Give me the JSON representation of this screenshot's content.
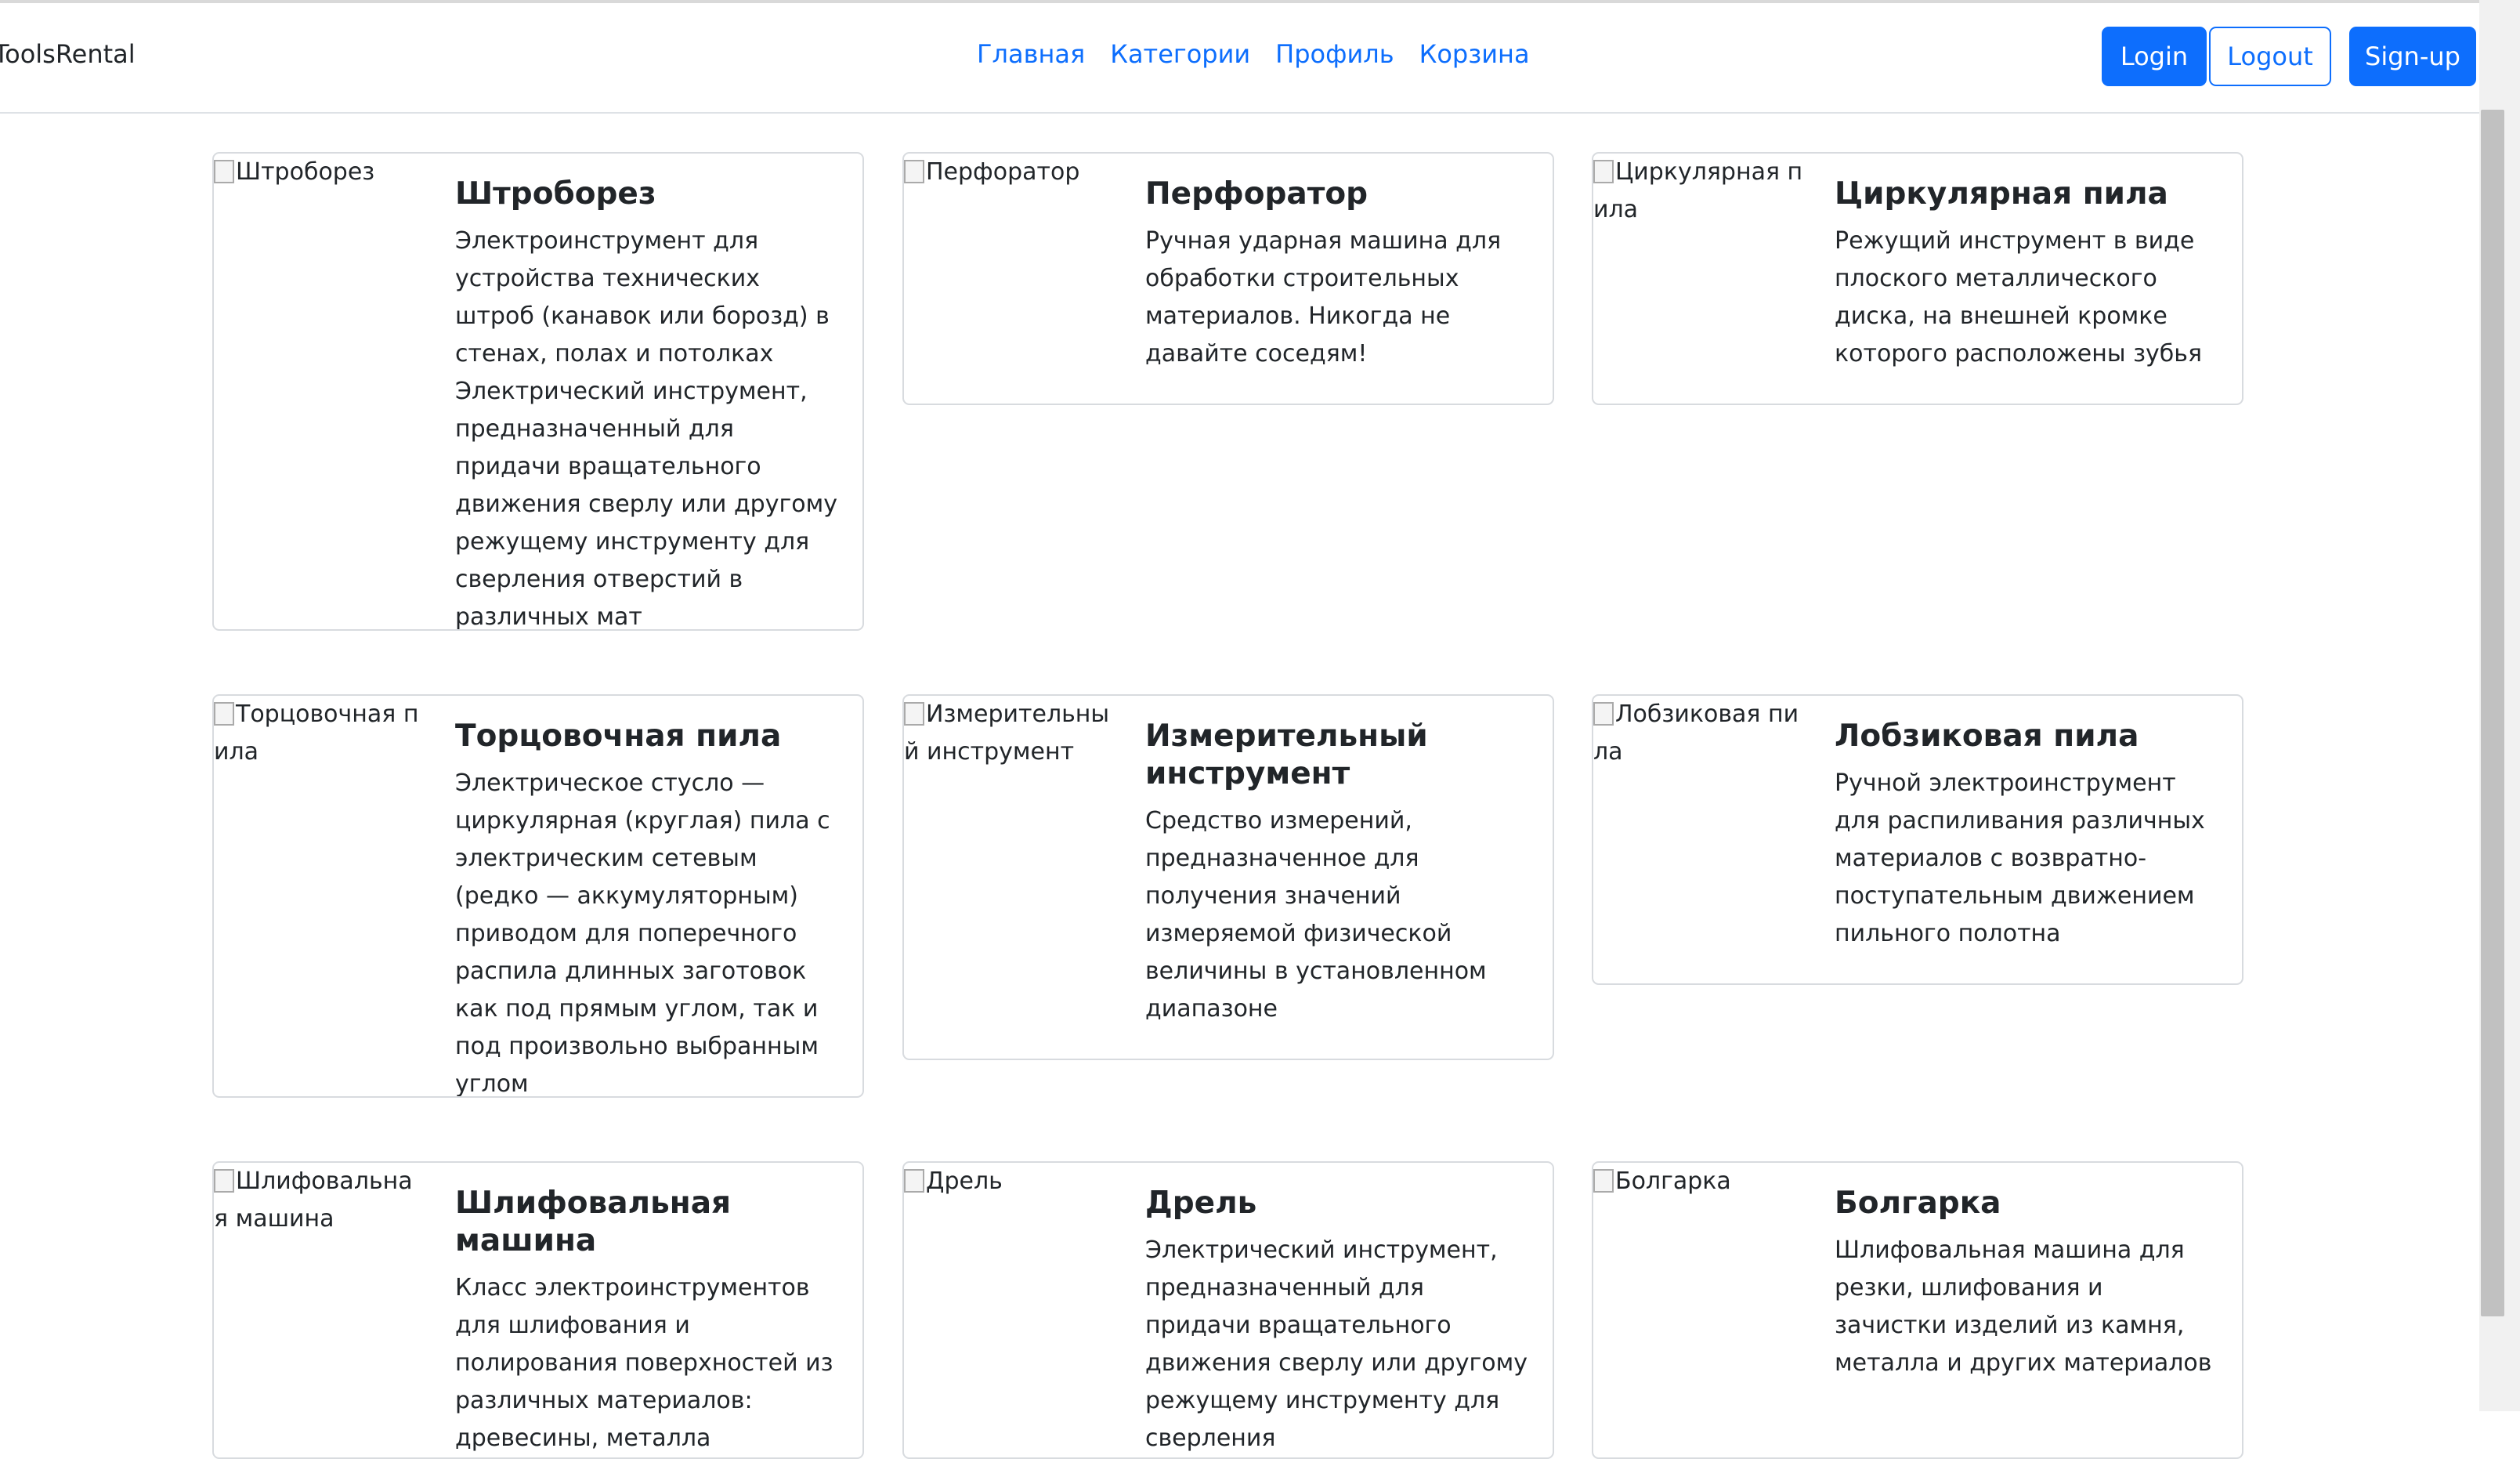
{
  "navbar": {
    "brand": "ToolsRental",
    "links": [
      "Главная",
      "Категории",
      "Профиль",
      "Корзина"
    ],
    "login": "Login",
    "logout": "Logout",
    "signup": "Sign-up"
  },
  "products": [
    {
      "img_alt": "Штроборез",
      "title": "Штроборез",
      "text": "Электроинструмент для устройства технических штроб (канавок или борозд) в стенах, полах и потолках Электрический инструмент, предназначенный для придачи вращательного движения сверлу или другому режущему инструменту для сверления отверстий в различных мат"
    },
    {
      "img_alt": "Перфоратор",
      "title": "Перфоратор",
      "text": "Ручная ударная машина для обработки строительных материалов. Никогда не давайте соседям!"
    },
    {
      "img_alt": "Циркулярная пила",
      "title": "Циркулярная пила",
      "text": "Режущий инструмент в виде плоского металлического диска, на внешней кромке которого расположены зубья"
    },
    {
      "img_alt": "Торцовочная пила",
      "title": "Торцовочная пила",
      "text": "Электрическое стусло — циркулярная (круглая) пила с электрическим сетевым (редко — аккумуляторным) приводом для поперечного распила длинных заготовок как под прямым углом, так и под произвольно выбранным углом"
    },
    {
      "img_alt": "Измерительный инструмент",
      "title": "Измерительный инструмент",
      "text": "Средство измерений, предназначенное для получения значений измеряемой физической величины в установленном диапазоне"
    },
    {
      "img_alt": "Лобзиковая пила",
      "title": "Лобзиковая пила",
      "text": "Ручной электроинструмент для распиливания различных материалов с возвратно-поступательным движением пильного полотна"
    },
    {
      "img_alt": "Шлифовальная машина",
      "title": "Шлифовальная машина",
      "text": "Класс электроинструментов для шлифования и полирования поверхностей из различных материалов: древесины, металла"
    },
    {
      "img_alt": "Дрель",
      "title": "Дрель",
      "text": "Электрический инструмент, предназначенный для придачи вращательного движения сверлу или другому режущему инструменту для сверления"
    },
    {
      "img_alt": "Болгарка",
      "title": "Болгарка",
      "text": "Шлифовальная машина для резки, шлифования и зачистки изделий из камня, металла и других материалов"
    }
  ]
}
